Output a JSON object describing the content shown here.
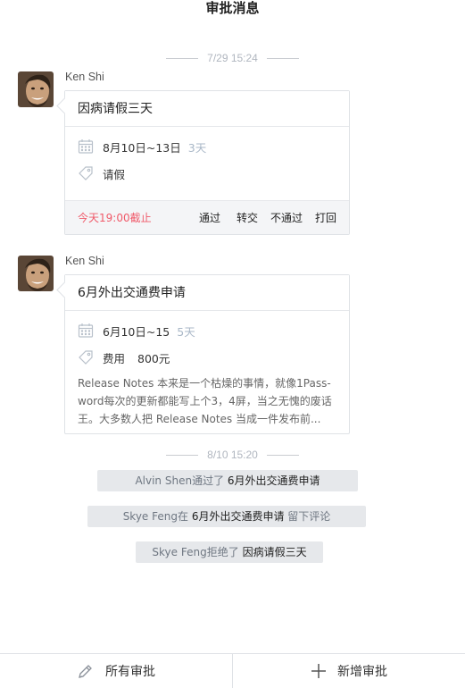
{
  "header": {
    "title": "审批消息"
  },
  "timestamps": [
    "7/29  15:24",
    "8/10  15:20"
  ],
  "messages": [
    {
      "sender": "Ken Shi",
      "title": "因病请假三天",
      "date_range": "8月10日~13日",
      "duration": "3天",
      "tag": "请假",
      "deadline": "今天19:00截止",
      "actions": [
        "通过",
        "转交",
        "不通过",
        "打回"
      ]
    },
    {
      "sender": "Ken Shi",
      "title": "6月外出交通费申请",
      "date_range": "6月10日~15",
      "duration": "5天",
      "tag": "费用",
      "amount": "800元",
      "description": "Release Notes 本来是一个枯燥的事情，就像1Pass-word每次的更新都能写上个3，4屏，当之无愧的废话王。大多数人把 Release Notes 当成一件发布前..."
    }
  ],
  "notices": [
    {
      "actor": "Alvin Shen",
      "verb": "通过了",
      "target": "6月外出交通费申请",
      "suffix": ""
    },
    {
      "actor": "Skye Feng",
      "verb": "在",
      "target": "6月外出交通费申请",
      "suffix": "留下评论"
    },
    {
      "actor": "Skye Feng",
      "verb": "拒绝了",
      "target": "因病请假三天",
      "suffix": ""
    }
  ],
  "bottom_tabs": [
    {
      "label": "所有审批",
      "icon": "pen-icon"
    },
    {
      "label": "新增审批",
      "icon": "plus-icon"
    }
  ],
  "colors": {
    "deadline": "#f05a6a",
    "muted": "#a9b7c7",
    "notice_bg": "#e6e8eb"
  }
}
